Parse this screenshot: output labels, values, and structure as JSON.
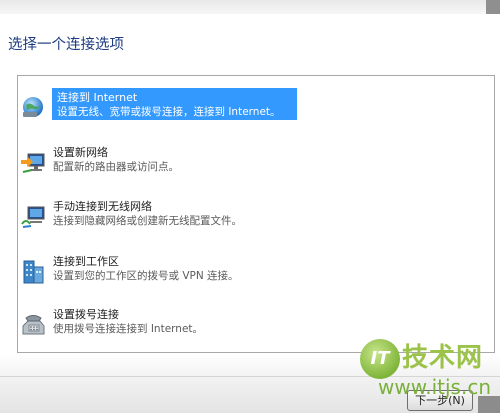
{
  "window": {
    "title": "选择一个连接选项"
  },
  "options": [
    {
      "label": "连接到 Internet",
      "description": "设置无线、宽带或拨号连接，连接到 Internet。",
      "icon": "globe-icon",
      "selected": true
    },
    {
      "label": "设置新网络",
      "description": "配置新的路由器或访问点。",
      "icon": "network-setup-icon",
      "selected": false
    },
    {
      "label": "手动连接到无线网络",
      "description": "连接到隐藏网络或创建新无线配置文件。",
      "icon": "wireless-network-icon",
      "selected": false
    },
    {
      "label": "连接到工作区",
      "description": "设置到您的工作区的拨号或 VPN 连接。",
      "icon": "workplace-icon",
      "selected": false
    },
    {
      "label": "设置拨号连接",
      "description": "使用拨号连接连接到 Internet。",
      "icon": "dialup-phone-icon",
      "selected": false
    }
  ],
  "footer": {
    "next_label": "下一步(N)"
  },
  "watermark": {
    "logo_letters": "IT",
    "brand": "技术网",
    "url": "www.itjs.cn"
  },
  "colors": {
    "title": "#1f3d82",
    "selection": "#3399ff",
    "watermark": "#9bc34a"
  }
}
